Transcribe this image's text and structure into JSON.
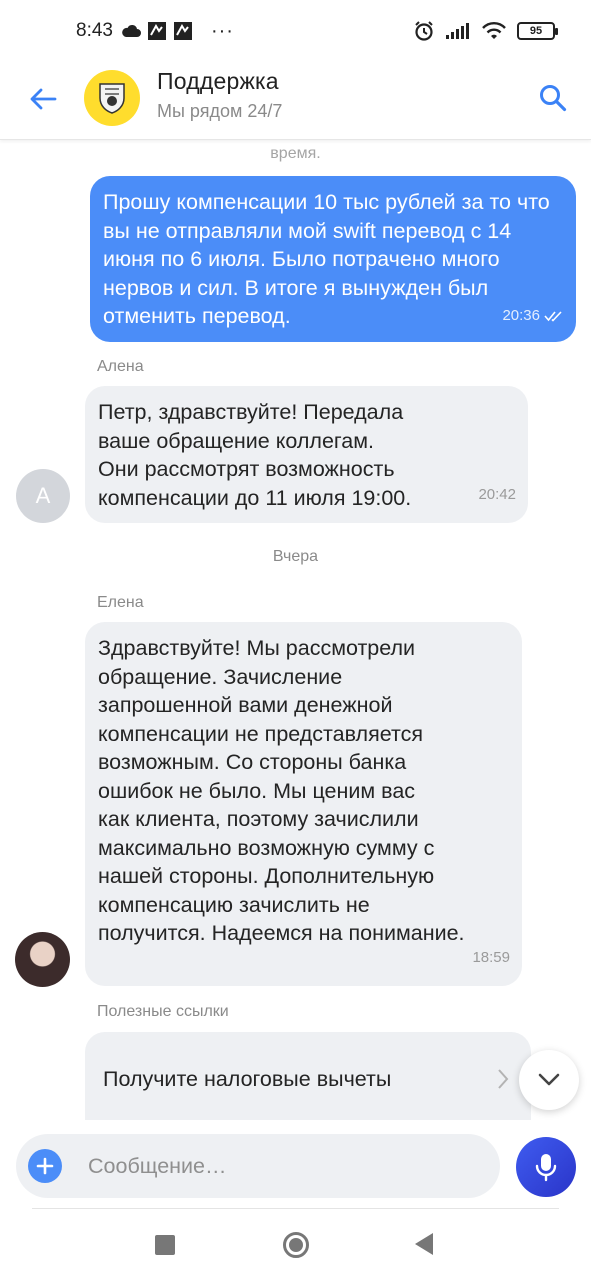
{
  "status_bar": {
    "time": "8:43",
    "battery": "95",
    "dots": "···"
  },
  "header": {
    "title": "Поддержка",
    "subtitle": "Мы рядом 24/7"
  },
  "chat": {
    "clipped_text": "время.",
    "messages": [
      {
        "direction": "out",
        "text": "Прошу компенсации 10 тыс рублей за то что вы не отправляли мой swift перевод с 14 июня по 6 июля. Было потрачено много нервов и сил. В итоге я вынужден был отменить перевод.",
        "time": "20:36"
      },
      {
        "direction": "in",
        "sender": "Алена",
        "avatar_letter": "А",
        "text_lines": [
          "Петр, здравствуйте! Передала",
          "ваше обращение коллегам.",
          "Они рассмотрят возможность",
          "компенсации до 11 июля 19:00."
        ],
        "time": "20:42"
      },
      {
        "direction": "in",
        "sender": "Елена",
        "text_lines": [
          "Здравствуйте! Мы рассмотрели",
          "обращение. Зачисление",
          "запрошенной вами денежной",
          "компенсации не представляется",
          "возможным. Со стороны банка",
          "ошибок не было. Мы ценим вас",
          "как клиента, поэтому зачислили",
          "максимально возможную сумму с",
          "нашей стороны. Дополнительную",
          "компенсацию зачислить не",
          "получится. Надеемся на понимание."
        ],
        "time": "18:59"
      }
    ],
    "day_separator": "Вчера",
    "links_label": "Полезные ссылки",
    "link_item": "Получите налоговые вычеты"
  },
  "input": {
    "placeholder": "Сообщение…"
  },
  "colors": {
    "accent": "#4b8df8",
    "bank_yellow": "#ffdd2d",
    "bubble_in": "#eef0f3",
    "mic": "#3f5cf0"
  }
}
